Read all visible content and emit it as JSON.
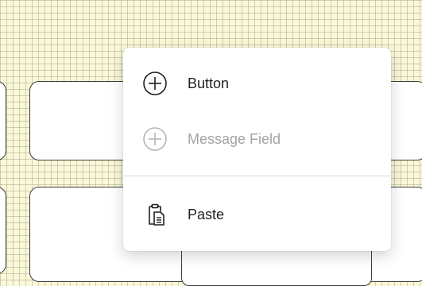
{
  "context_menu": {
    "items": [
      {
        "label": "Button",
        "icon": "add-circle-icon",
        "enabled": true
      },
      {
        "label": "Message Field",
        "icon": "add-circle-icon",
        "enabled": false
      },
      {
        "label": "Paste",
        "icon": "clipboard-paste-icon",
        "enabled": true
      }
    ]
  },
  "colors": {
    "grid_background": "#fbf8d8",
    "menu_background": "#ffffff",
    "text": "#1f1f1f",
    "disabled_text": "#a3a3a3",
    "panel_border": "#3c3c3c"
  }
}
